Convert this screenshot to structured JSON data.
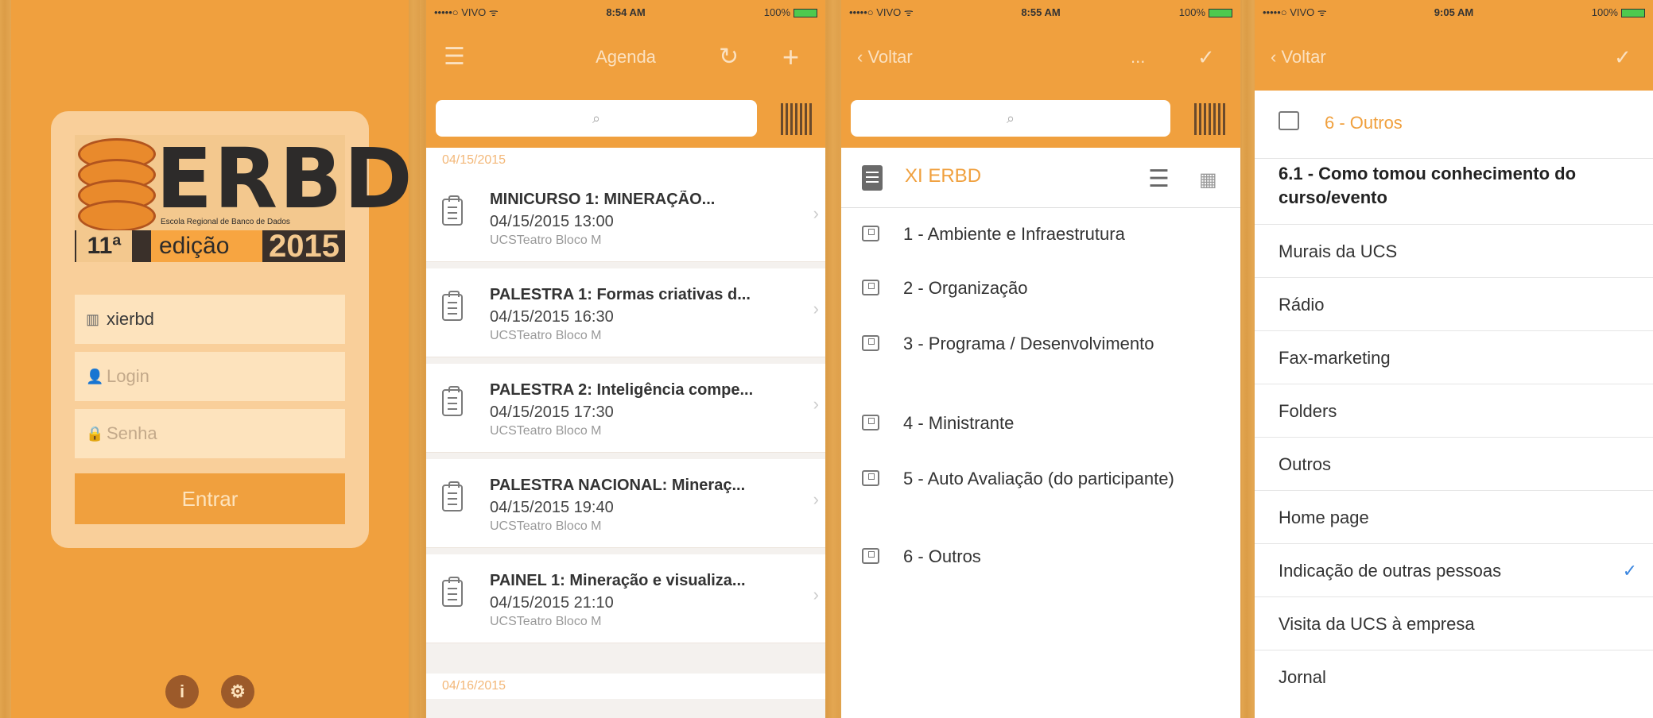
{
  "login": {
    "logo": {
      "word": "ERBD",
      "subtitle": "Escola Regional de Banco de Dados",
      "edition_number": "11ª",
      "edition_label": "edição",
      "year": "2015"
    },
    "username_value": "xierbd",
    "login_placeholder": "Login",
    "password_placeholder": "Senha",
    "enter_label": "Entrar",
    "info_label": "i"
  },
  "status": [
    {
      "carrier": "•••••○ VIVO ᯤ",
      "time": "8:54 AM",
      "battery": "100%"
    },
    {
      "carrier": "•••••○ VIVO ᯤ",
      "time": "8:55 AM",
      "battery": "100%"
    },
    {
      "carrier": "•••••○ VIVO ᯤ",
      "time": "9:05 AM",
      "battery": "100%"
    }
  ],
  "agenda": {
    "title": "Agenda",
    "dates": [
      "04/15/2015",
      "04/16/2015"
    ],
    "events": [
      {
        "title": "MINICURSO 1: MINERAÇÃO...",
        "when": "04/15/2015 13:00",
        "where": "UCSTeatro Bloco M"
      },
      {
        "title": "PALESTRA 1: Formas criativas d...",
        "when": "04/15/2015 16:30",
        "where": "UCSTeatro Bloco M"
      },
      {
        "title": "PALESTRA 2: Inteligência compe...",
        "when": "04/15/2015 17:30",
        "where": "UCSTeatro Bloco M"
      },
      {
        "title": "PALESTRA NACIONAL: Mineraç...",
        "when": "04/15/2015 19:40",
        "where": "UCSTeatro Bloco M"
      },
      {
        "title": "PAINEL 1: Mineração e visualiza...",
        "when": "04/15/2015 21:10",
        "where": "UCSTeatro Bloco M"
      }
    ]
  },
  "survey": {
    "back_label": "Voltar",
    "more_label": "...",
    "doc_title": "XI ERBD",
    "categories": [
      "1 - Ambiente e Infraestrutura",
      "2 - Organização",
      "3 - Programa / Desenvolvimento",
      "4 - Ministrante",
      "5 - Auto Avaliação (do participante)",
      "6 - Outros"
    ]
  },
  "options": {
    "back_label": "Voltar",
    "section": "6 - Outros",
    "question": "6.1 - Como tomou conhecimento do curso/evento",
    "items": [
      "Murais da UCS",
      "Rádio",
      "Fax-marketing",
      "Folders",
      "Outros",
      "Home page",
      "Indicação de outras pessoas",
      "Visita da UCS à empresa",
      "Jornal"
    ],
    "selected": "Indicação de outras pessoas"
  },
  "colors": {
    "accent": "#f0a03e",
    "card": "#f9cf9a",
    "check": "#3b86e0"
  }
}
